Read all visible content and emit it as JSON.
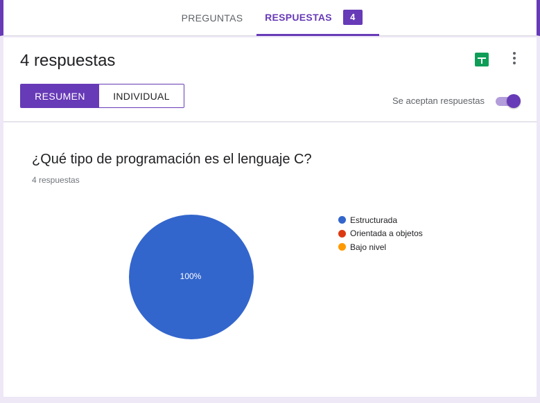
{
  "tabs": {
    "preguntas": "PREGUNTAS",
    "respuestas": "RESPUESTAS",
    "respuestas_count": "4"
  },
  "summary": {
    "title": "4 respuestas",
    "view_resumen": "RESUMEN",
    "view_individual": "INDIVIDUAL",
    "accepting_label": "Se aceptan respuestas",
    "accepting_enabled": true,
    "icons": [
      "sheets-icon",
      "more-vert-icon"
    ]
  },
  "question": {
    "title": "¿Qué tipo de programación es el lenguaje C?",
    "count": "4 respuestas"
  },
  "chart_data": {
    "type": "pie",
    "categories": [
      "Estructurada",
      "Orientada a objetos",
      "Bajo nivel"
    ],
    "values": [
      100,
      0,
      0
    ],
    "colors": [
      "#3366cc",
      "#dc3912",
      "#ff9900"
    ],
    "slice_label": "100%",
    "legend_position": "right"
  }
}
